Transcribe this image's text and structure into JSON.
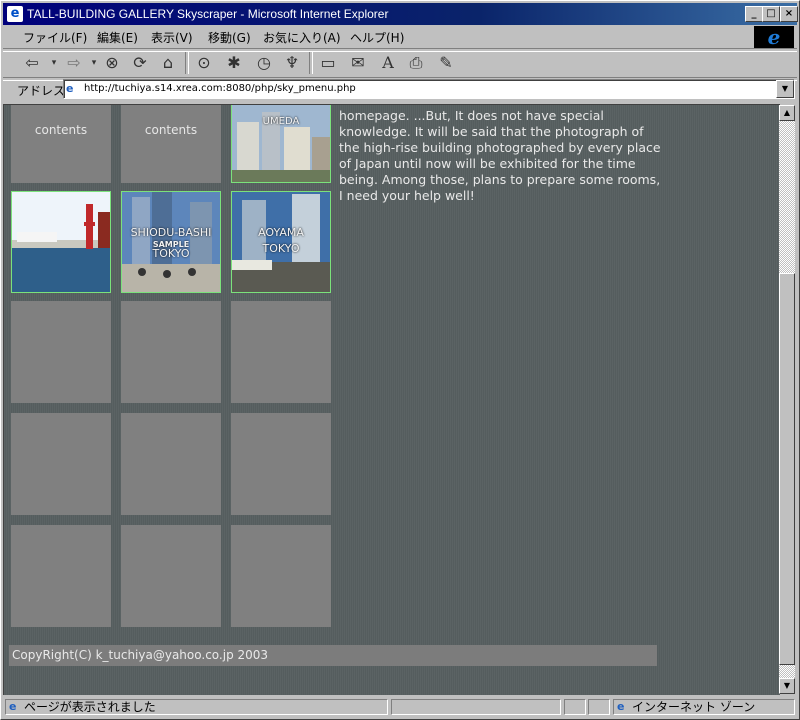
{
  "window": {
    "title": "TALL-BUILDING GALLERY Skyscraper - Microsoft Internet Explorer",
    "minimize_symbol": "_",
    "maximize_symbol": "□",
    "close_symbol": "×"
  },
  "menu": {
    "items": [
      "ファイル(F)",
      "編集(E)",
      "表示(V)",
      "移動(G)",
      "お気に入り(A)",
      "ヘルプ(H)"
    ]
  },
  "toolbar": {
    "icons": [
      "back-icon",
      "forward-icon",
      "stop-icon",
      "refresh-icon",
      "home-icon",
      "search-icon",
      "favorites-icon",
      "history-icon",
      "channels-icon",
      "fullscreen-icon",
      "mail-icon",
      "font-icon",
      "print-icon",
      "edit-icon"
    ]
  },
  "address": {
    "label": "アドレス",
    "url": "http://tuchiya.s14.xrea.com:8080/php/sky_pmenu.php"
  },
  "page": {
    "tiles": {
      "r1c1": "contents",
      "r1c2": "contents",
      "r1c3_label": "UMEDA",
      "r2c2_label1": "SHIODU-BASHI",
      "r2c2_label2": "SAMPLE",
      "r2c2_label3": "TOKYO",
      "r2c3_label1": "AOYAMA",
      "r2c3_label2": "TOKYO"
    },
    "intro_text": "homepage. ...But, It does not have special knowledge. It will be said that the photograph of the high-rise building photographed by every place of Japan until now will be exhibited for the time being. Among those, plans to prepare some rooms, I need your help well!",
    "footer": "CopyRight(C) k_tuchiya@yahoo.co.jp 2003"
  },
  "status": {
    "message": "ページが表示されました",
    "zone": "インターネット ゾーン"
  },
  "colors": {
    "page_bg": "#596162",
    "tile_bg": "#808080",
    "tile_border_active": "#7be27b",
    "title_bar": "#00007b"
  }
}
